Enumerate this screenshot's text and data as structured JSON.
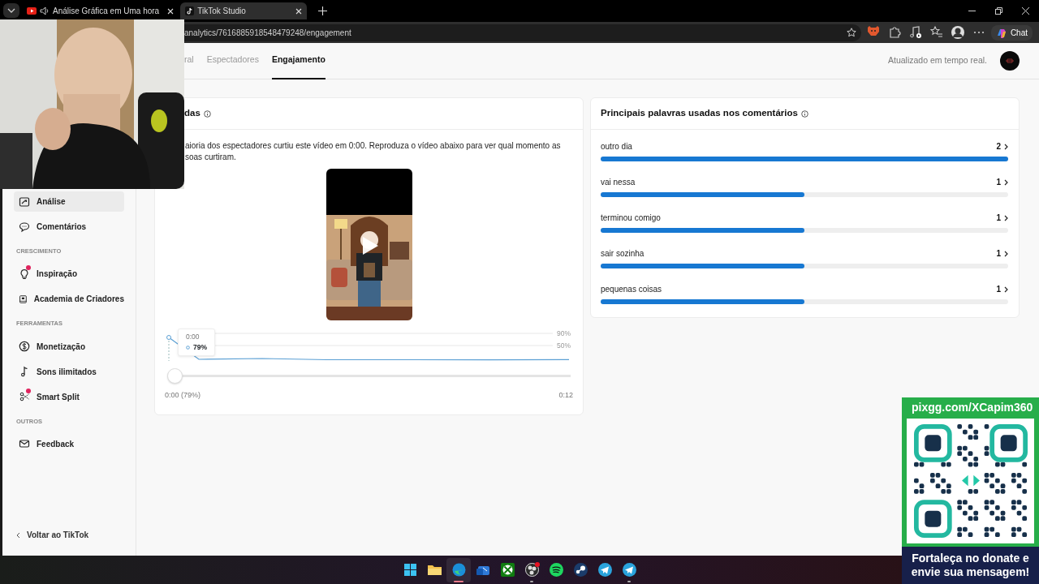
{
  "browser": {
    "tabs": [
      {
        "title": "Análise Gráfica em Uma hora",
        "kind": "youtube",
        "audio": true,
        "selected": false
      },
      {
        "title": "TikTok Studio",
        "kind": "tiktok",
        "audio": false,
        "selected": true
      }
    ],
    "url": "analytics/7616885918548479248/engagement",
    "chat_label": "Chat"
  },
  "header": {
    "tabs": [
      {
        "label": "ral",
        "selected": false
      },
      {
        "label": "Espectadores",
        "selected": false
      },
      {
        "label": "Engajamento",
        "selected": true
      }
    ],
    "status": "Atualizado em tempo real."
  },
  "sidebar": {
    "sections": [
      {
        "items": [
          {
            "label": "Análise",
            "kind": "analytics",
            "selected": true,
            "dot": false
          },
          {
            "label": "Comentários",
            "kind": "comments",
            "selected": false,
            "dot": false
          }
        ]
      },
      {
        "heading": "CRESCIMENTO",
        "items": [
          {
            "label": "Inspiração",
            "kind": "inspiration",
            "selected": false,
            "dot": true
          },
          {
            "label": "Academia de Criadores",
            "kind": "academy",
            "selected": false,
            "dot": false
          }
        ]
      },
      {
        "heading": "FERRAMENTAS",
        "items": [
          {
            "label": "Monetização",
            "kind": "money",
            "selected": false,
            "dot": false
          },
          {
            "label": "Sons ilimitados",
            "kind": "sounds",
            "selected": false,
            "dot": false
          },
          {
            "label": "Smart Split",
            "kind": "split",
            "selected": false,
            "dot": true
          }
        ]
      },
      {
        "heading": "OUTROS",
        "items": [
          {
            "label": "Feedback",
            "kind": "feedback",
            "selected": false,
            "dot": false
          }
        ]
      }
    ],
    "back_link": "Voltar ao TikTok"
  },
  "likes_card": {
    "title": "das",
    "description_lines": [
      "aioria dos espectadores curtiu este vídeo em 0:00. Reproduza o vídeo abaixo para ver qual momento as",
      "soas curtiram."
    ],
    "video": {
      "kind": "picture"
    },
    "chart_labels": [
      "90%",
      "50%"
    ],
    "tooltip": {
      "time": "0:00",
      "value": "79%"
    },
    "slider": {
      "level": 0
    },
    "start_label": "0:00 (79%)",
    "end_label": "0:12"
  },
  "words_card": {
    "title": "Principais palavras usadas nos comentários",
    "words": [
      {
        "word": "outro dia",
        "count": "2",
        "level": 1
      },
      {
        "word": "vai nessa",
        "count": "1",
        "level": 0.5
      },
      {
        "word": "terminou comigo",
        "count": "1",
        "level": 0.5
      },
      {
        "word": "sair sozinha",
        "count": "1",
        "level": 0.5
      },
      {
        "word": "pequenas coisas",
        "count": "1",
        "level": 0.5
      }
    ]
  },
  "webcam": {
    "kind": "picture"
  },
  "donation": {
    "url": "pixgg.com/XCapim360",
    "message": "Fortaleça no donate e envie sua mensagem!"
  },
  "taskbar": [
    {
      "kind": "windows",
      "active": false,
      "running": false
    },
    {
      "kind": "folder",
      "active": false,
      "running": false
    },
    {
      "kind": "edge",
      "active": true,
      "running": true
    },
    {
      "kind": "mail",
      "active": false,
      "running": false
    },
    {
      "kind": "xbox",
      "active": false,
      "running": false
    },
    {
      "kind": "obs",
      "active": false,
      "running": true
    },
    {
      "kind": "spotify",
      "active": false,
      "running": false
    },
    {
      "kind": "steam",
      "active": false,
      "running": false
    },
    {
      "kind": "telegram",
      "active": false,
      "running": false
    },
    {
      "kind": "telegram",
      "active": false,
      "running": true
    }
  ]
}
